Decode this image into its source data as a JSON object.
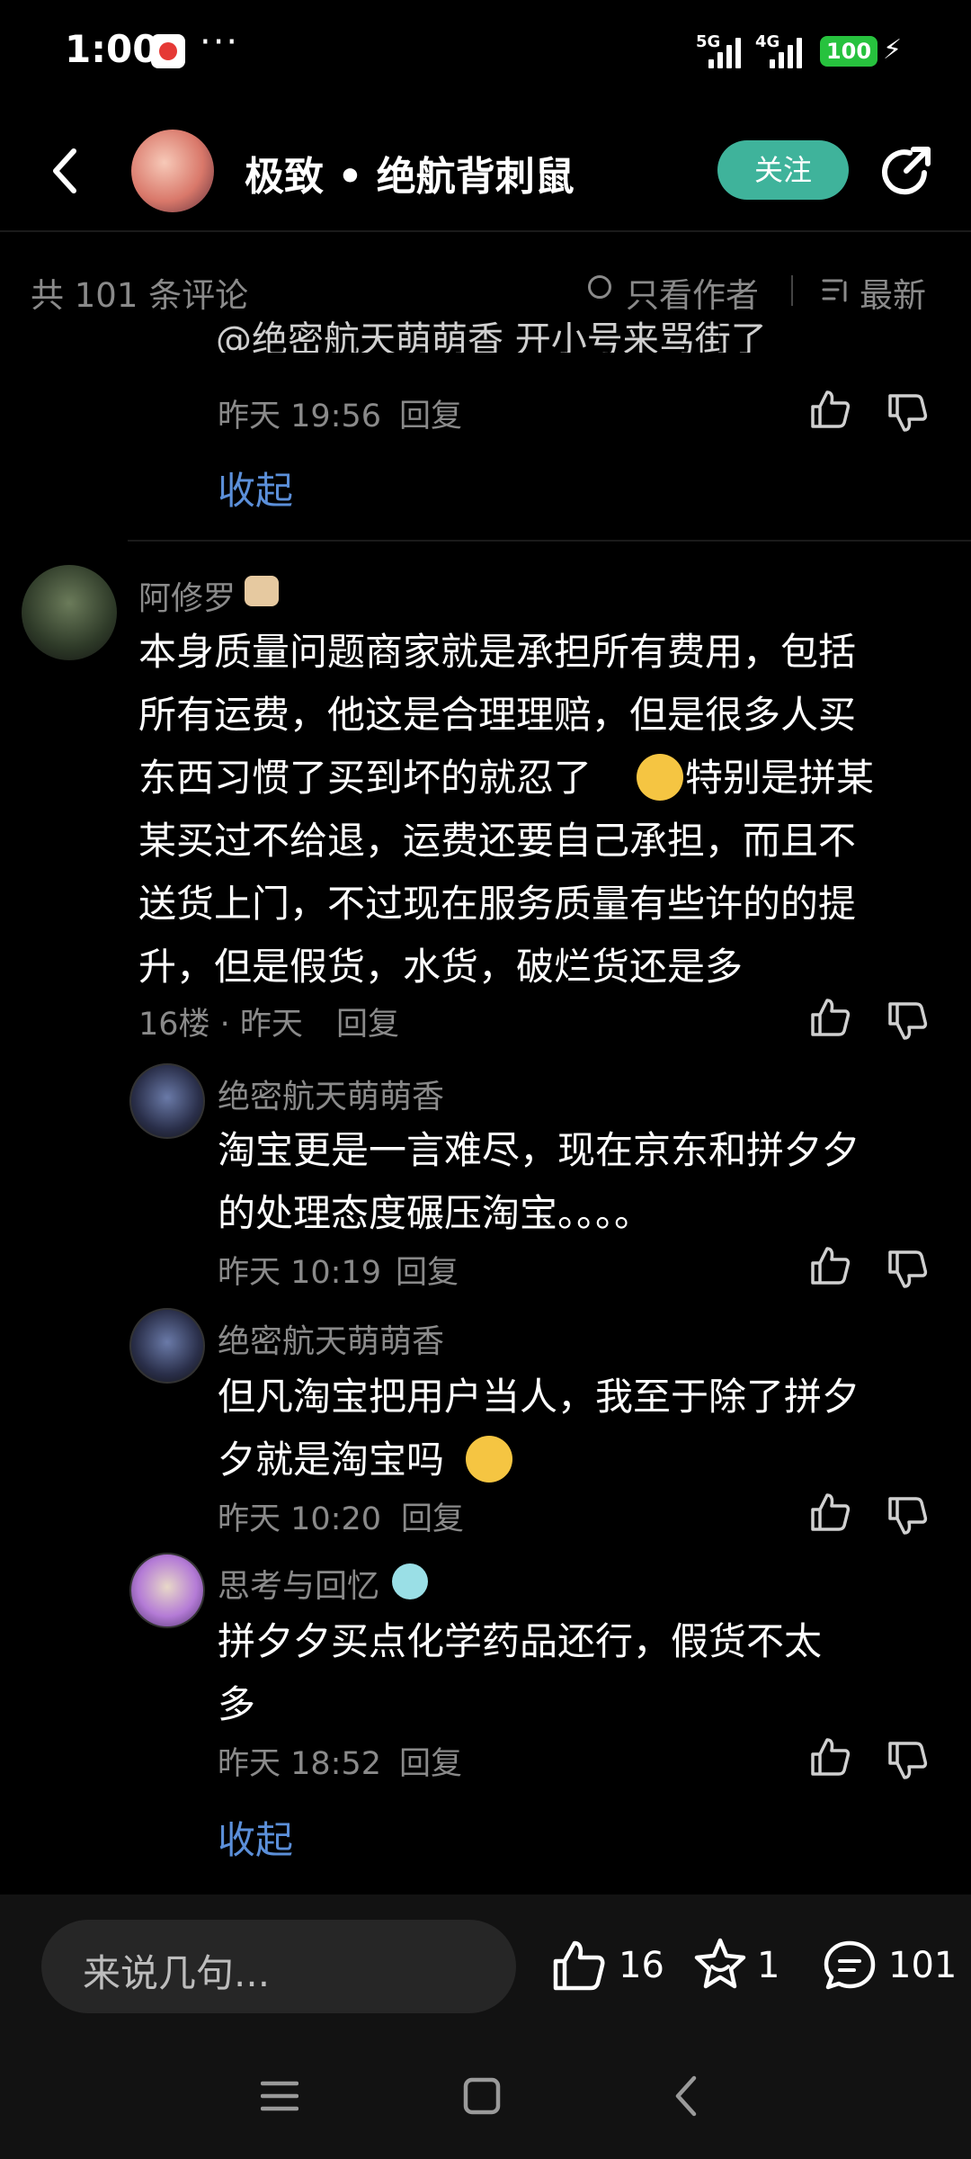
{
  "status": {
    "time": "1:00",
    "dots": "···",
    "net1": "5G",
    "net2": "4G",
    "battery": "100"
  },
  "header": {
    "title": "极致 • 绝航背刺鼠",
    "follow_label": "关注"
  },
  "toolbar": {
    "count": "共 101 条评论",
    "author_only": "只看作者",
    "sort": "最新"
  },
  "partial_top": {
    "text": "@绝密航天萌萌香 开小号来骂街了",
    "time": "昨天 19:56",
    "reply": "回复",
    "collapse": "收起"
  },
  "comment": {
    "name": "阿修罗",
    "text_lines": [
      "本身质量问题商家就是承担所有费用，包括",
      "所有运费，他这是合理理赔，但是很多人买",
      "东西习惯了买到坏的就忍了",
      "特别是拼某",
      "某买过不给退，运费还要自己承担，而且不",
      "送货上门，不过现在服务质量有些许的的提",
      "升，但是假货，水货，破烂货还是多"
    ],
    "meta": "16楼 · 昨天",
    "reply": "回复"
  },
  "replies": [
    {
      "name": "绝密航天萌萌香",
      "lines": [
        "淘宝更是一言难尽，现在京东和拼夕夕",
        "的处理态度碾压淘宝。。。。"
      ],
      "time": "昨天 10:19",
      "reply": "回复"
    },
    {
      "name": "绝密航天萌萌香",
      "lines": [
        "但凡淘宝把用户当人，我至于除了拼夕",
        "夕就是淘宝吗"
      ],
      "time": "昨天 10:20",
      "reply": "回复"
    },
    {
      "name": "思考与回忆",
      "lines": [
        "拼夕夕买点化学药品还行，假货不太",
        "多"
      ],
      "time": "昨天 18:52",
      "reply": "回复"
    }
  ],
  "collapse2": "收起",
  "bottom": {
    "placeholder": "来说几句...",
    "likes": "16",
    "stars": "1",
    "comments": "101"
  }
}
